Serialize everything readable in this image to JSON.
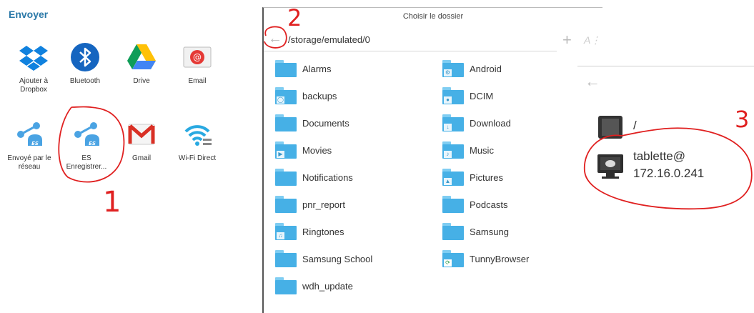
{
  "share": {
    "title": "Envoyer",
    "items": [
      {
        "label": "Ajouter à Dropbox",
        "icon": "dropbox-icon"
      },
      {
        "label": "Bluetooth",
        "icon": "bluetooth-icon"
      },
      {
        "label": "Drive",
        "icon": "drive-icon"
      },
      {
        "label": "Email",
        "icon": "email-icon"
      },
      {
        "label": "Envoyé par le réseau",
        "icon": "es-network-icon"
      },
      {
        "label": "ES Enregistrer...",
        "icon": "es-save-icon"
      },
      {
        "label": "Gmail",
        "icon": "gmail-icon"
      },
      {
        "label": "Wi-Fi Direct",
        "icon": "wifi-direct-icon"
      }
    ]
  },
  "chooser": {
    "title": "Choisir le dossier",
    "path": "/storage/emulated/0",
    "left_folders": [
      "Alarms",
      "backups",
      "Documents",
      "Movies",
      "Notifications",
      "pnr_report",
      "Ringtones",
      "Samsung School",
      "wdh_update"
    ],
    "right_folders": [
      "Android",
      "DCIM",
      "Download",
      "Music",
      "Pictures",
      "Podcasts",
      "Samsung",
      "TunnyBrowser"
    ]
  },
  "network": {
    "root_label": "/",
    "device_line1": "tablette@",
    "device_line2": "172.16.0.241"
  },
  "annotations": {
    "step1": "1",
    "step2": "2",
    "step3": "3"
  },
  "colors": {
    "folder": "#46b0e6",
    "accent": "#2b79a8",
    "annotation": "#e02020"
  }
}
